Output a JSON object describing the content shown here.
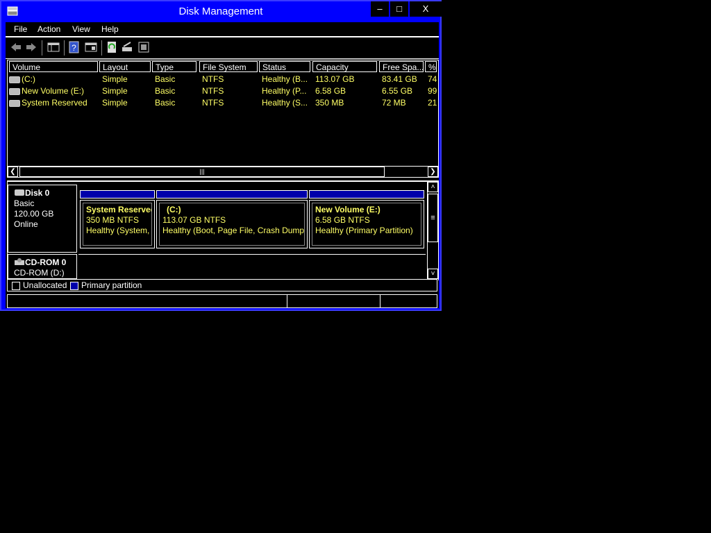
{
  "window": {
    "title": "Disk Management",
    "min_label": "–",
    "max_label": "□",
    "close_label": "X"
  },
  "menu": [
    "File",
    "Action",
    "View",
    "Help"
  ],
  "toolbar": [
    "back-arrow-icon",
    "forward-arrow-icon",
    "console-tree-icon",
    "help-icon",
    "properties-icon",
    "refresh-icon",
    "rescan-disks-icon",
    "connect-icon"
  ],
  "columns": [
    "Volume",
    "Layout",
    "Type",
    "File System",
    "Status",
    "Capacity",
    "Free Spa...",
    "% F"
  ],
  "volumes": [
    {
      "volume": "(C:)",
      "layout": "Simple",
      "type": "Basic",
      "fs": "NTFS",
      "status": "Healthy (B...",
      "capacity": "113.07 GB",
      "free": "83.41 GB",
      "pct": "74"
    },
    {
      "volume": "New Volume (E:)",
      "layout": "Simple",
      "type": "Basic",
      "fs": "NTFS",
      "status": "Healthy (P...",
      "capacity": "6.58 GB",
      "free": "6.55 GB",
      "pct": "99"
    },
    {
      "volume": "System Reserved",
      "layout": "Simple",
      "type": "Basic",
      "fs": "NTFS",
      "status": "Healthy (S...",
      "capacity": "350 MB",
      "free": "72 MB",
      "pct": "21"
    }
  ],
  "disks": {
    "disk0": {
      "name": "Disk 0",
      "kind": "Basic",
      "size": "120.00 GB",
      "state": "Online",
      "partitions": [
        {
          "name": "System Reserved",
          "size": "350 MB NTFS",
          "status": "Healthy (System, Active, Primary Partition)"
        },
        {
          "name": "(C:)",
          "size": "113.07 GB NTFS",
          "status": "Healthy (Boot, Page File, Crash Dump, Primary Partition)"
        },
        {
          "name": "New Volume  (E:)",
          "size": "6.58 GB NTFS",
          "status": "Healthy (Primary Partition)"
        }
      ]
    },
    "cdrom0": {
      "name": "CD-ROM 0",
      "drive": "CD-ROM (D:)"
    }
  },
  "legend": {
    "unallocated": "Unallocated",
    "primary": "Primary partition"
  },
  "colors": {
    "frame": "#0000ff",
    "text_values": "#ffff66",
    "primary_partition": "#0000aa"
  }
}
